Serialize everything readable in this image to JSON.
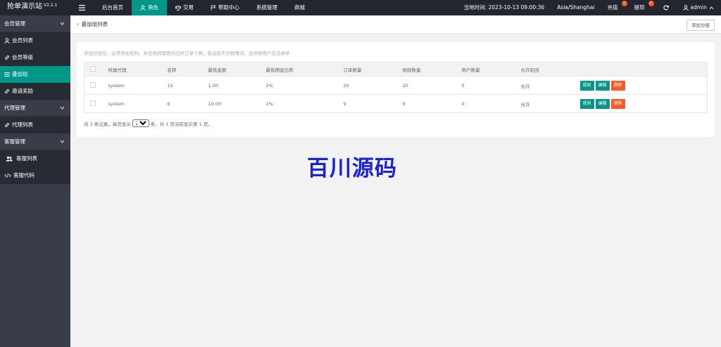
{
  "header": {
    "logo": "抢单演示站",
    "version": "V2.2.1",
    "nav": [
      {
        "label": "后台首页"
      },
      {
        "label": "角色"
      },
      {
        "label": "交易"
      },
      {
        "label": "帮助中心"
      },
      {
        "label": "系统管理"
      },
      {
        "label": "商城"
      }
    ],
    "time_label": "当地时间: 2023-10-13 09:00:36",
    "timezone": "Asia/Shanghai",
    "recharge_label": "充值",
    "recharge_badge": "1",
    "withdraw_label": "提现",
    "withdraw_badge": "0",
    "user": "admin"
  },
  "sidebar": {
    "groups": [
      {
        "label": "会员管理",
        "items": [
          {
            "label": "会员列表"
          },
          {
            "label": "会员等级"
          },
          {
            "label": "叠加组"
          },
          {
            "label": "邀请奖励"
          }
        ]
      },
      {
        "label": "代理管理",
        "items": [
          {
            "label": "代理列表"
          }
        ]
      },
      {
        "label": "客服管理",
        "items": [
          {
            "label": "客服列表"
          },
          {
            "label": "客服代码"
          }
        ]
      }
    ]
  },
  "breadcrumb": "叠加组列表",
  "add_button": "添加分组",
  "hint": "添加分组后，必须添加规则，并且规则需要对应好订单个数，若出现不对称情况，会导致用户无法做单",
  "table": {
    "columns": [
      "所属代理",
      "名称",
      "最低金额",
      "最低佣金比例",
      "订单数量",
      "规则数量",
      "用户数量",
      "允许轮回"
    ],
    "rows": [
      {
        "agent": "system",
        "name": "15",
        "min_amount": "1.00",
        "min_ratio": "2%",
        "orders": "20",
        "rules": "20",
        "users": "0",
        "loop": "允许"
      },
      {
        "agent": "system",
        "name": "6",
        "min_amount": "10.00",
        "min_ratio": "1%",
        "orders": "9",
        "rules": "9",
        "users": "0",
        "loop": "允许"
      }
    ],
    "actions": {
      "rule": "规则",
      "edit": "编辑",
      "delete": "删除"
    }
  },
  "pager": {
    "prefix": "共 2 条记录，每页显示",
    "page_size": "20",
    "suffix": "条，共 1 页当前显示第 1 页。"
  },
  "watermark": "百川源码",
  "colors": {
    "accent": "#009688",
    "danger": "#ff5722",
    "header": "#23262e",
    "sidebar": "#393d49"
  }
}
